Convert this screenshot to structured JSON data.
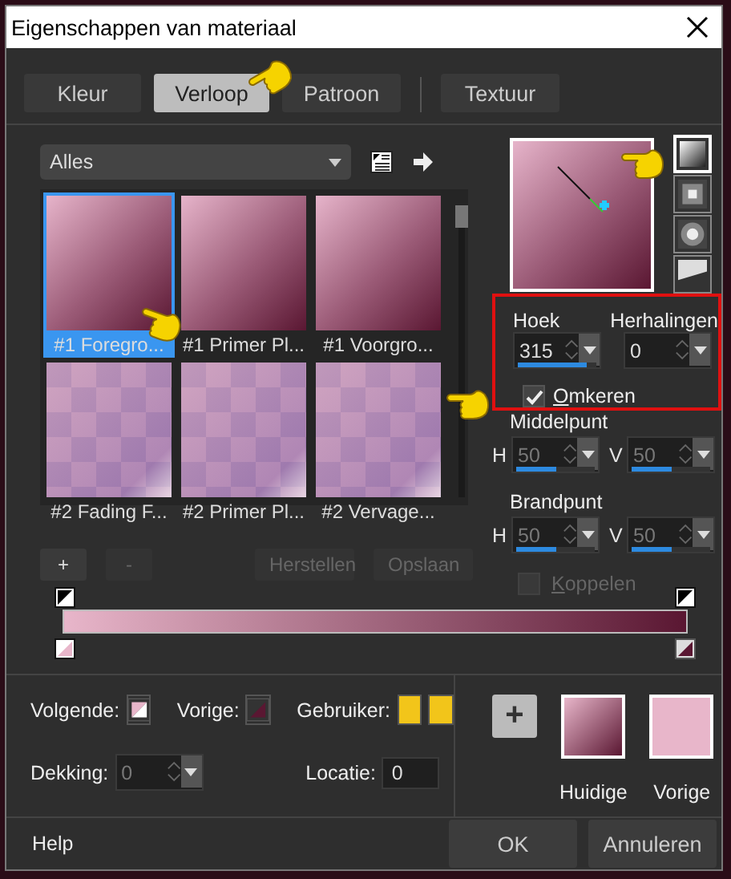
{
  "window": {
    "title": "Eigenschappen van materiaal"
  },
  "tabs": [
    {
      "label": "Kleur",
      "selected": false
    },
    {
      "label": "Verloop",
      "selected": true
    },
    {
      "label": "Patroon",
      "selected": false
    },
    {
      "label": "Textuur",
      "selected": false
    }
  ],
  "category": {
    "value": "Alles"
  },
  "gradients": [
    {
      "label": "#1 Foregro...",
      "kind": "solid",
      "selected": true
    },
    {
      "label": "#1 Primer Pl...",
      "kind": "solid",
      "selected": false
    },
    {
      "label": "#1 Voorgro...",
      "kind": "solid",
      "selected": false
    },
    {
      "label": "#2 Fading F...",
      "kind": "fading",
      "selected": false
    },
    {
      "label": "#2 Primer Pl...",
      "kind": "fading",
      "selected": false
    },
    {
      "label": "#2 Vervage...",
      "kind": "fading",
      "selected": false
    }
  ],
  "styles": [
    {
      "kind": "linear",
      "selected": true
    },
    {
      "kind": "rectangular",
      "selected": false
    },
    {
      "kind": "sunburst",
      "selected": false
    },
    {
      "kind": "radial",
      "selected": false
    }
  ],
  "angle": {
    "label": "Hoek",
    "value": "315",
    "level": 0.88
  },
  "repeats": {
    "label": "Herhalingen",
    "value": "0"
  },
  "invert": {
    "label": "Omkeren",
    "checked": true
  },
  "center": {
    "label": "Middelpunt",
    "disabled": true,
    "h": {
      "label": "H",
      "value": "50",
      "level": 0.5
    },
    "v": {
      "label": "V",
      "value": "50",
      "level": 0.5
    }
  },
  "focal": {
    "label": "Brandpunt",
    "disabled": true,
    "h": {
      "label": "H",
      "value": "50",
      "level": 0.5
    },
    "v": {
      "label": "V",
      "value": "50",
      "level": 0.5
    }
  },
  "link": {
    "label": "Koppelen",
    "checked": false,
    "disabled": true
  },
  "stop_buttons": [
    {
      "label": "+",
      "disabled": false
    },
    {
      "label": "-",
      "disabled": true
    },
    {
      "label": "Herstellen",
      "disabled": true
    },
    {
      "label": "Opslaan",
      "disabled": true
    }
  ],
  "stops": [
    {
      "color": "#e8b6ca",
      "selected": true
    },
    {
      "color": "#5a1732",
      "selected": false
    }
  ],
  "next": {
    "label": "Volgende:"
  },
  "previous": {
    "label": "Vorige:"
  },
  "user": {
    "label": "Gebruiker:"
  },
  "opacity": {
    "label": "Dekking:",
    "value": "0",
    "disabled": true
  },
  "location": {
    "label": "Locatie:",
    "value": "0"
  },
  "add_button": {
    "label": "+"
  },
  "current": {
    "label": "Huidige"
  },
  "previous_swatch": {
    "label": "Vorige"
  },
  "footer": {
    "help": "Help",
    "ok": "OK",
    "cancel": "Annuleren"
  }
}
